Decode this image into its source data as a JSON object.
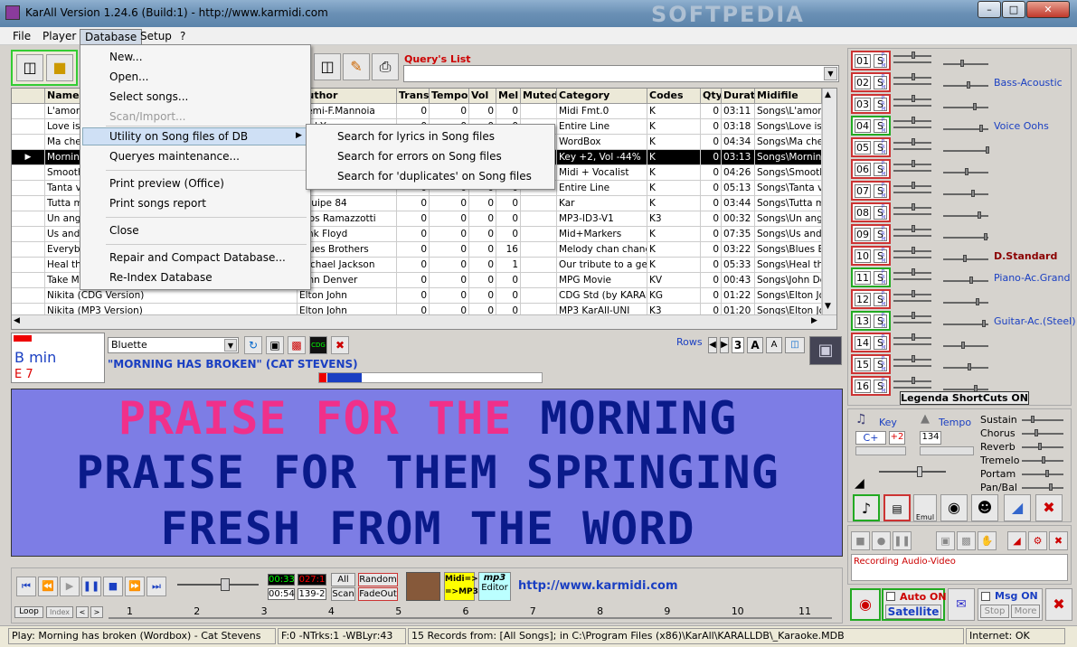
{
  "window": {
    "title": "KarAll Version 1.24.6 (Build:1) - http://www.karmidi.com",
    "watermark": "SOFTPEDIA"
  },
  "menu": [
    "File",
    "Player",
    "Database",
    "Setup",
    "?"
  ],
  "db_menu": {
    "items": [
      "New...",
      "Open...",
      "Select songs...",
      "Scan/Import...",
      "Utility on Song files of DB",
      "Queryes maintenance...",
      "Print preview (Office)",
      "Print songs report",
      "Close",
      "Repair and Compact Database...",
      "Re-Index Database"
    ],
    "submenu": [
      "Search for lyrics in Song files",
      "Search for errors on Song files",
      "Search for 'duplicates' on Song files"
    ]
  },
  "query": {
    "label": "Query's List",
    "value": ""
  },
  "grid": {
    "columns": [
      "Name",
      "Author",
      "Trans",
      "Tempo",
      "Vol",
      "Mel",
      "Muted",
      "Category",
      "Codes",
      "Qty",
      "Durat",
      "Midifile"
    ],
    "rows": [
      [
        "L'amore",
        "Gemi-F.Mannoia",
        "0",
        "0",
        "0",
        "0",
        "",
        "Midi Fmt.0",
        "K",
        "0",
        "03:11",
        "Songs\\L'amore"
      ],
      [
        "Love is",
        "Red Y.",
        "0",
        "0",
        "0",
        "0",
        "",
        "Entire Line",
        "K",
        "0",
        "03:18",
        "Songs\\Love is"
      ],
      [
        "Ma che",
        "",
        "0",
        "0",
        "0",
        "0",
        "",
        "WordBox",
        "K",
        "0",
        "04:34",
        "Songs\\Ma che"
      ],
      [
        "Morning",
        "",
        "0",
        "0",
        "0",
        "0",
        "",
        "Key +2, Vol -44%",
        "K",
        "0",
        "03:13",
        "Songs\\Morning"
      ],
      [
        "Smooth",
        "",
        "0",
        "0",
        "0",
        "0",
        "",
        "Midi + Vocalist",
        "K",
        "0",
        "04:26",
        "Songs\\Smooth"
      ],
      [
        "Tanta vo",
        "",
        "0",
        "0",
        "0",
        "0",
        "",
        "Entire Line",
        "K",
        "0",
        "05:13",
        "Songs\\Tanta vo"
      ],
      [
        "Tutta m",
        "Equipe 84",
        "0",
        "0",
        "0",
        "0",
        "",
        "Kar",
        "K",
        "0",
        "03:44",
        "Songs\\Tutta mi"
      ],
      [
        "Un ang",
        "Eros Ramazzotti",
        "0",
        "0",
        "0",
        "0",
        "",
        "MP3-ID3-V1",
        "K3",
        "0",
        "00:32",
        "Songs\\Un ange"
      ],
      [
        "Us and",
        "Pink Floyd",
        "0",
        "0",
        "0",
        "0",
        "",
        "Mid+Markers",
        "K",
        "0",
        "07:35",
        "Songs\\Us and t"
      ],
      [
        "Everyb",
        "Blues Brothers",
        "0",
        "0",
        "0",
        "16",
        "",
        "Melody chan chang",
        "K",
        "0",
        "03:22",
        "Songs\\Blues Br"
      ],
      [
        "Heal th",
        "Michael Jackson",
        "0",
        "0",
        "0",
        "1",
        "",
        "Our tribute to a geni",
        "K",
        "0",
        "05:33",
        "Songs\\Heal the"
      ],
      [
        "Take M",
        "John Denver",
        "0",
        "0",
        "0",
        "0",
        "",
        "MPG Movie",
        "KV",
        "0",
        "00:43",
        "Songs\\John De"
      ],
      [
        "Nikita (CDG Version)",
        "Elton John",
        "0",
        "0",
        "0",
        "0",
        "",
        "CDG Std (by KARAI",
        "KG",
        "0",
        "01:22",
        "Songs\\Elton Jol"
      ],
      [
        "Nikita (MP3 Version)",
        "Elton John",
        "0",
        "0",
        "0",
        "0",
        "",
        "MP3 KarAll-UNI",
        "K3",
        "0",
        "01:20",
        "Songs\\Elton Jol"
      ]
    ],
    "selected_row": 3
  },
  "player": {
    "key_name": "B min",
    "key_code": "E 7",
    "font": "Bluette",
    "rows_label": "Rows",
    "rows_value": "3",
    "song": "\"MORNING HAS BROKEN\" (CAT STEVENS)"
  },
  "lyrics": {
    "line1_sung": "PRAISE FOR THE ",
    "line1_rest": "MORNING",
    "line2": "PRAISE FOR THEM SPRINGING",
    "line3": "FRESH FROM THE WORD"
  },
  "channels": {
    "numbers": [
      "01",
      "02",
      "03",
      "04",
      "05",
      "06",
      "07",
      "08",
      "09",
      "10",
      "11",
      "12",
      "13",
      "14",
      "15",
      "16"
    ],
    "solo": "S",
    "instruments": [
      {
        "ch": 2,
        "name": "Bass-Acoustic"
      },
      {
        "ch": 4,
        "name": "Voice Oohs"
      },
      {
        "ch": 10,
        "name": "D.Standard"
      },
      {
        "ch": 11,
        "name": "Piano-Ac.Grand"
      },
      {
        "ch": 13,
        "name": "Guitar-Ac.(Steel)"
      }
    ],
    "legend": "Legenda ShortCuts ON"
  },
  "controls": {
    "key_label": "Key",
    "tempo_label": "Tempo",
    "key_value": "C+",
    "key_shift": "+2",
    "tempo_value": "134",
    "effects": [
      "Sustain",
      "Chorus",
      "Reverb",
      "Tremelo",
      "Portam",
      "Pan/Bal"
    ],
    "emul": "Emul"
  },
  "transport": {
    "time1": "00:33",
    "time2": "027:1",
    "time3": "00:54",
    "time4": "139-2",
    "all": "All",
    "random": "Random",
    "scan": "Scan",
    "fadeout": "FadeOut",
    "midi2mp3": "Midi=> =>MP3",
    "mp3editor": "Editor",
    "url": "http://www.karmidi.com",
    "loop": "Loop",
    "index": "Index",
    "ticks": [
      "1",
      "2",
      "3",
      "4",
      "5",
      "6",
      "7",
      "8",
      "9",
      "10",
      "11"
    ]
  },
  "recording": {
    "label": "Recording Audio-Video"
  },
  "bottom_right": {
    "auto_on": "Auto ON",
    "satellite": "Satellite",
    "msg_on": "Msg ON",
    "stop": "Stop",
    "more": "More"
  },
  "status": {
    "s1": "Play: Morning has broken (Wordbox) - Cat Stevens",
    "s2": "F:0 -NTrks:1 -WBLyr:43",
    "s3": "15 Records from: [All Songs]; in C:\\Program Files (x86)\\KarAll\\KARALLDB\\_Karaoke.MDB",
    "s4": "Internet: OK"
  }
}
